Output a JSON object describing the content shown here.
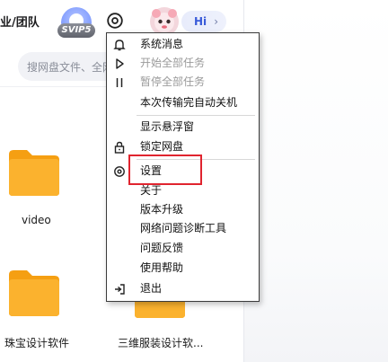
{
  "header": {
    "left_text": "业/团队",
    "vip_badge": "SVIP5",
    "hi_label": "Hi",
    "hi_chevron": "›"
  },
  "search": {
    "placeholder": "搜网盘文件、全网"
  },
  "files": [
    {
      "label": "video"
    },
    {
      "label": "珠宝设计软件"
    },
    {
      "label": "三维服装设计软..."
    }
  ],
  "menu": {
    "items": [
      {
        "label": "系统消息",
        "icon": "bell-icon",
        "disabled": false
      },
      {
        "label": "开始全部任务",
        "icon": "play-icon",
        "disabled": true
      },
      {
        "label": "暂停全部任务",
        "icon": "pause-icon",
        "disabled": true
      },
      {
        "label": "本次传输完自动关机",
        "icon": "",
        "disabled": false
      },
      {
        "label": "显示悬浮窗",
        "icon": "",
        "disabled": false
      },
      {
        "label": "锁定网盘",
        "icon": "lock-icon",
        "disabled": false
      },
      {
        "label": "设置",
        "icon": "gear-icon",
        "disabled": false
      },
      {
        "label": "关于",
        "icon": "",
        "disabled": false
      },
      {
        "label": "版本升级",
        "icon": "",
        "disabled": false
      },
      {
        "label": "网络问题诊断工具",
        "icon": "",
        "disabled": false
      },
      {
        "label": "问题反馈",
        "icon": "",
        "disabled": false
      },
      {
        "label": "使用帮助",
        "icon": "",
        "disabled": false
      },
      {
        "label": "退出",
        "icon": "exit-icon",
        "disabled": false
      }
    ]
  },
  "colors": {
    "highlight": "#e0242f",
    "folder": "#f7a21b",
    "accent": "#3a5bd9"
  }
}
